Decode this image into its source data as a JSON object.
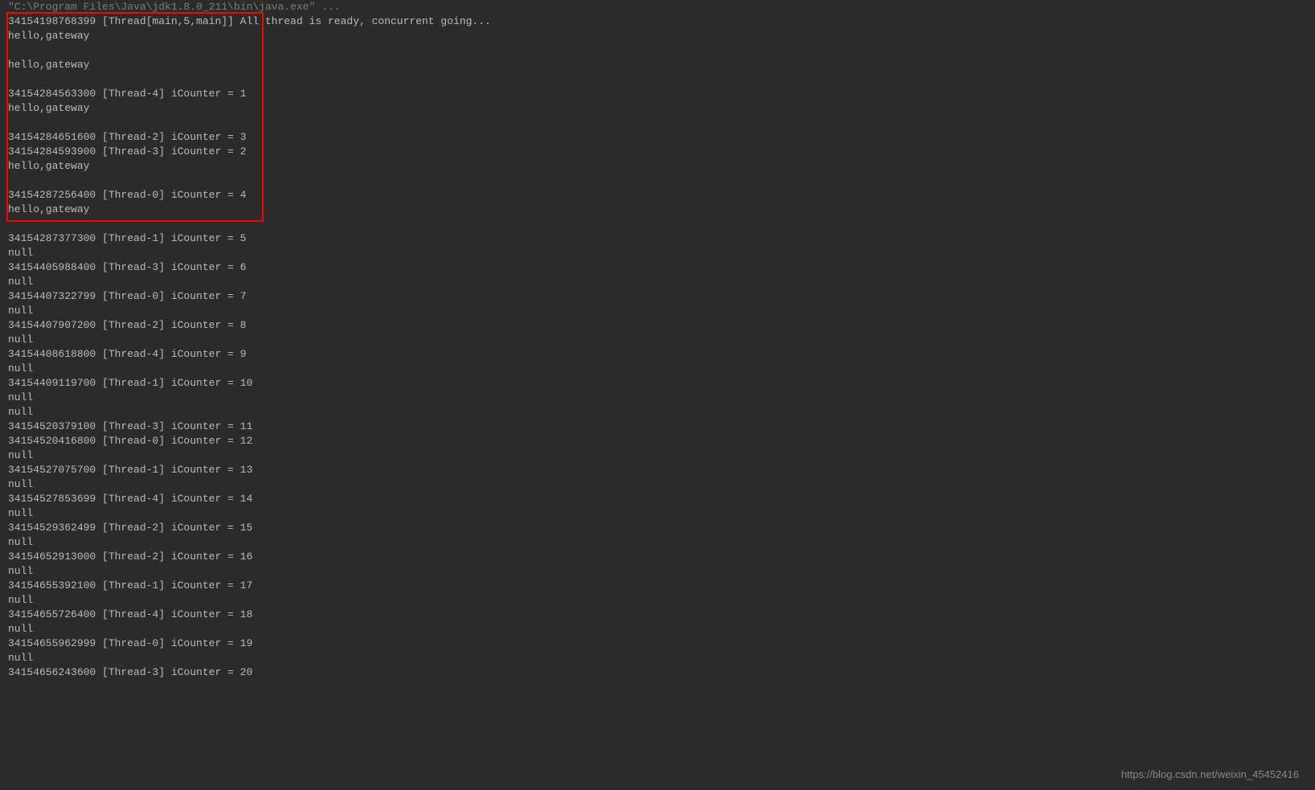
{
  "console": {
    "header": "\"C:\\Program Files\\Java\\jdk1.8.0_211\\bin\\java.exe\" ...",
    "lines": [
      "34154198768399 [Thread[main,5,main]] All thread is ready, concurrent going...",
      "hello,gateway",
      "",
      "hello,gateway",
      "",
      "34154284563300 [Thread-4] iCounter = 1",
      "hello,gateway",
      "",
      "34154284651600 [Thread-2] iCounter = 3",
      "34154284593900 [Thread-3] iCounter = 2",
      "hello,gateway",
      "",
      "34154287256400 [Thread-0] iCounter = 4",
      "hello,gateway",
      "",
      "34154287377300 [Thread-1] iCounter = 5",
      "null",
      "34154405988400 [Thread-3] iCounter = 6",
      "null",
      "34154407322799 [Thread-0] iCounter = 7",
      "null",
      "34154407907200 [Thread-2] iCounter = 8",
      "null",
      "34154408618800 [Thread-4] iCounter = 9",
      "null",
      "34154409119700 [Thread-1] iCounter = 10",
      "null",
      "null",
      "34154520379100 [Thread-3] iCounter = 11",
      "34154520416800 [Thread-0] iCounter = 12",
      "null",
      "34154527075700 [Thread-1] iCounter = 13",
      "null",
      "34154527853699 [Thread-4] iCounter = 14",
      "null",
      "34154529362499 [Thread-2] iCounter = 15",
      "null",
      "34154652913000 [Thread-2] iCounter = 16",
      "null",
      "34154655392100 [Thread-1] iCounter = 17",
      "null",
      "34154655726400 [Thread-4] iCounter = 18",
      "null",
      "34154655962999 [Thread-0] iCounter = 19",
      "null",
      "34154656243600 [Thread-3] iCounter = 20"
    ]
  },
  "watermark": "https://blog.csdn.net/weixin_45452416"
}
